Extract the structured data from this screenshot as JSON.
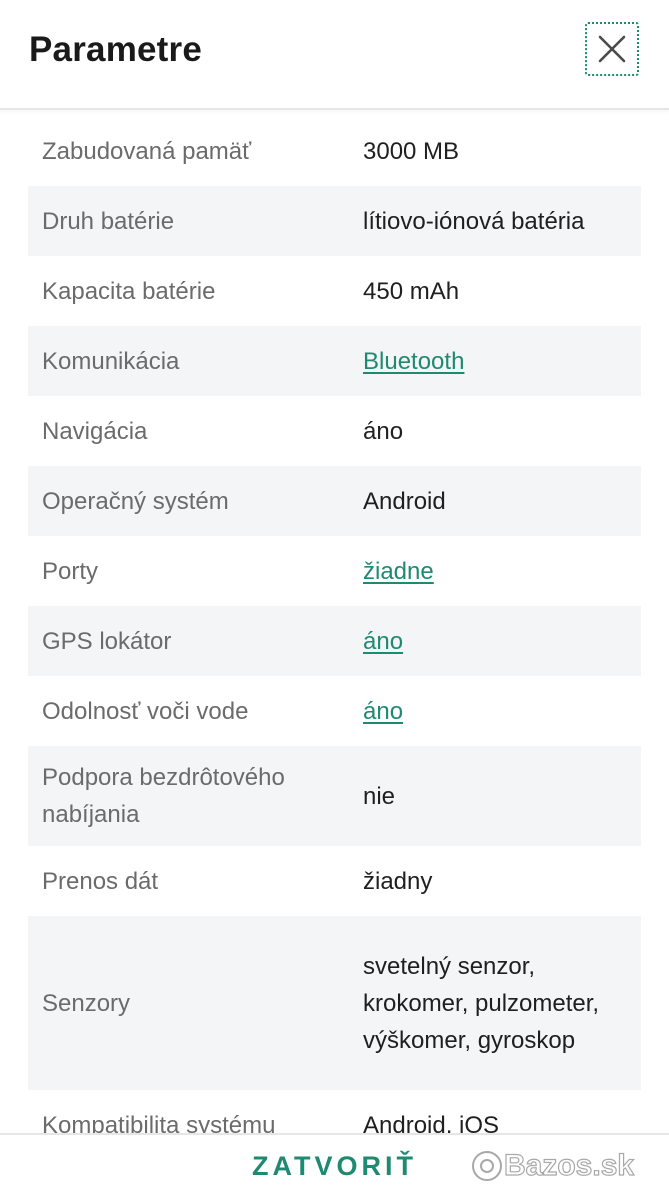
{
  "header": {
    "title": "Parametre",
    "close_icon": "close-icon"
  },
  "rows": [
    {
      "label": "Zabudovaná pamäť",
      "value": "3000 MB",
      "link": false
    },
    {
      "label": "Druh batérie",
      "value": "lítiovo-iónová batéria",
      "link": false
    },
    {
      "label": "Kapacita batérie",
      "value": "450 mAh",
      "link": false
    },
    {
      "label": "Komunikácia",
      "value": "Bluetooth",
      "link": true
    },
    {
      "label": "Navigácia",
      "value": "áno",
      "link": false
    },
    {
      "label": "Operačný systém",
      "value": "Android",
      "link": false
    },
    {
      "label": "Porty",
      "value": "žiadne",
      "link": true
    },
    {
      "label": "GPS lokátor",
      "value": "áno",
      "link": true
    },
    {
      "label": "Odolnosť voči vode",
      "value": "áno",
      "link": true
    },
    {
      "label": "Podpora bezdrôtového nabíjania",
      "value": "nie",
      "link": false
    },
    {
      "label": "Prenos dát",
      "value": "žiadny",
      "link": false
    },
    {
      "label": "Senzory",
      "value": "svetelný senzor, krokomer, pulzometer, výškomer, gyroskop",
      "link": false
    },
    {
      "label": "Kompatibilita systému",
      "value": "Android, iOS",
      "link": false
    }
  ],
  "footer": {
    "close_label": "ZATVORIŤ",
    "watermark": "Bazos.sk"
  },
  "colors": {
    "accent": "#1f8a72",
    "row_shade": "#f4f5f7",
    "label": "#6b6b6b"
  }
}
